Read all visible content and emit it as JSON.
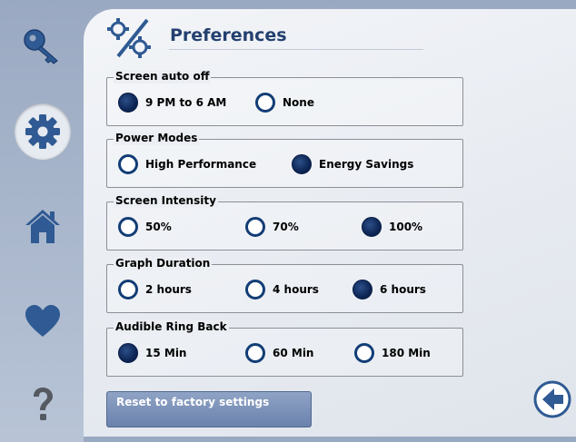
{
  "nav": {
    "items": [
      {
        "icon": "key-icon"
      },
      {
        "icon": "gear-icon"
      },
      {
        "icon": "home-icon"
      },
      {
        "icon": "heart-icon"
      },
      {
        "icon": "help-icon"
      }
    ]
  },
  "header": {
    "title": "Preferences",
    "icon": "preferences-gears-icon"
  },
  "groups": [
    {
      "label": "Screen auto off",
      "options": [
        {
          "label": "9 PM to 6 AM",
          "selected": true
        },
        {
          "label": "None",
          "selected": false
        }
      ]
    },
    {
      "label": "Power Modes",
      "options": [
        {
          "label": "High Performance",
          "selected": false
        },
        {
          "label": "Energy Savings",
          "selected": true
        }
      ]
    },
    {
      "label": "Screen Intensity",
      "options": [
        {
          "label": "50%",
          "selected": false
        },
        {
          "label": "70%",
          "selected": false
        },
        {
          "label": "100%",
          "selected": true
        }
      ]
    },
    {
      "label": "Graph Duration",
      "options": [
        {
          "label": "2 hours",
          "selected": false
        },
        {
          "label": "4 hours",
          "selected": false
        },
        {
          "label": "6 hours",
          "selected": true
        }
      ]
    },
    {
      "label": "Audible Ring Back",
      "options": [
        {
          "label": "15 Min",
          "selected": true
        },
        {
          "label": "60 Min",
          "selected": false
        },
        {
          "label": "180 Min",
          "selected": false
        }
      ]
    }
  ],
  "footer": {
    "reset_label": "Reset to factory settings",
    "back_icon": "back-arrow-icon"
  },
  "colors": {
    "accent": "#123d76",
    "title": "#23406f",
    "nav_icon": "#2f5a93"
  }
}
